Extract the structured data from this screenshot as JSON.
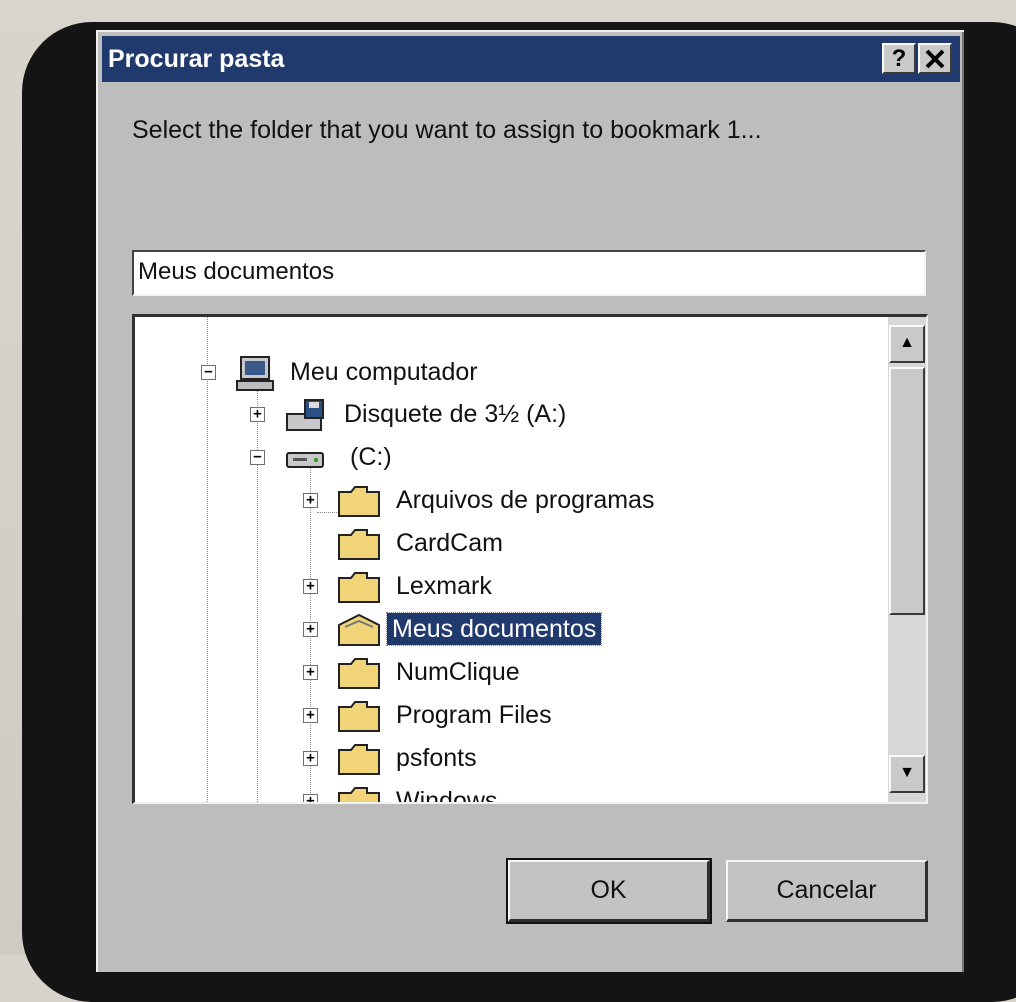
{
  "dialog": {
    "title": "Procurar pasta",
    "help_button": "?",
    "close_button": "✕",
    "instruction": "Select the folder that you want to assign to bookmark 1...",
    "path_value": "Meus documentos",
    "ok_label": "OK",
    "cancel_label": "Cancelar",
    "title_color": "#213a6e"
  },
  "tree": {
    "root": {
      "label": "Meu computador",
      "icon": "computer-icon",
      "expanded": true
    },
    "drives": [
      {
        "label": "Disquete de 3½ (A:)",
        "icon": "floppy-drive-icon",
        "expanded": false
      },
      {
        "label": "(C:)",
        "icon": "hard-drive-icon",
        "expanded": true
      }
    ],
    "folders": [
      {
        "label": "Arquivos de programas",
        "icon": "folder-icon",
        "has_children": true,
        "selected": false
      },
      {
        "label": "CardCam",
        "icon": "folder-icon",
        "has_children": false,
        "selected": false
      },
      {
        "label": "Lexmark",
        "icon": "folder-icon",
        "has_children": true,
        "selected": false
      },
      {
        "label": "Meus documentos",
        "icon": "documents-folder-icon",
        "has_children": true,
        "selected": true
      },
      {
        "label": "NumClique",
        "icon": "folder-icon",
        "has_children": true,
        "selected": false
      },
      {
        "label": "Program Files",
        "icon": "folder-icon",
        "has_children": true,
        "selected": false
      },
      {
        "label": "psfonts",
        "icon": "folder-icon",
        "has_children": true,
        "selected": false
      },
      {
        "label": "Windows",
        "icon": "folder-icon",
        "has_children": true,
        "selected": false
      }
    ]
  },
  "scrollbar": {
    "up_arrow": "▲",
    "down_arrow": "▼"
  }
}
